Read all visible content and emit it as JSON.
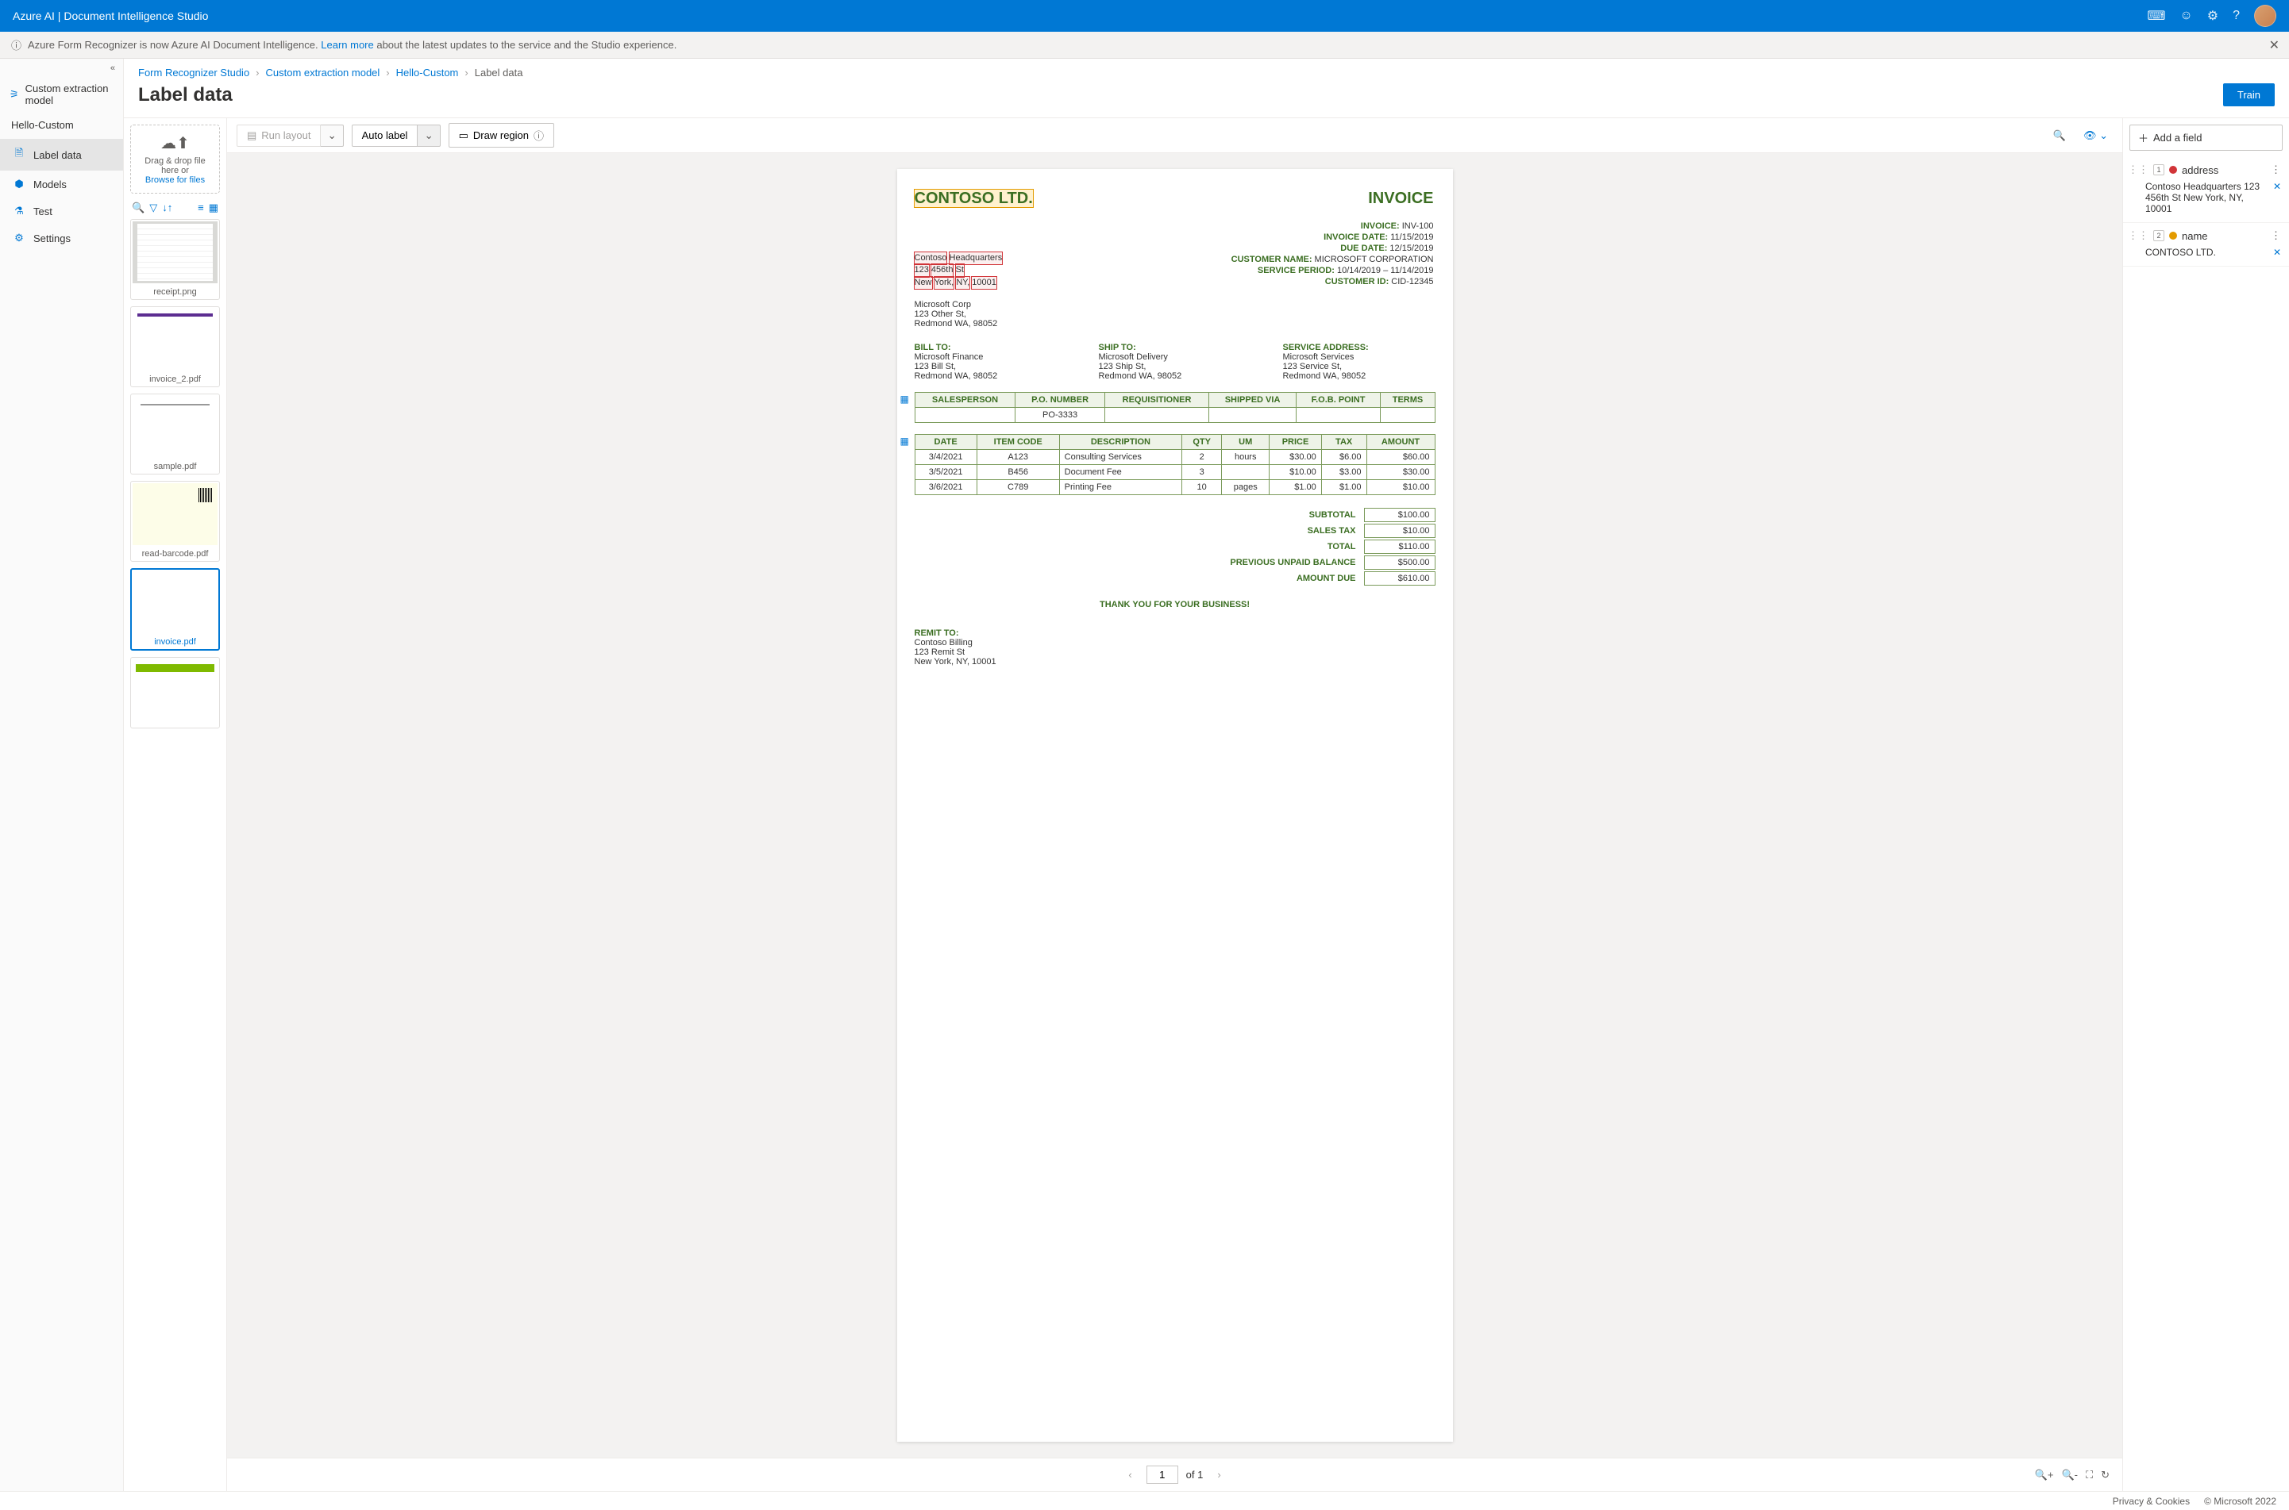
{
  "header": {
    "title": "Azure AI | Document Intelligence Studio"
  },
  "notif": {
    "prefix": "Azure Form Recognizer is now Azure AI Document Intelligence. ",
    "link": "Learn more",
    "suffix": " about the latest updates to the service and the Studio experience."
  },
  "nav": {
    "modelType": "Custom extraction model",
    "project": "Hello-Custom",
    "items": [
      {
        "label": "Label data",
        "icon": "🗎",
        "active": true
      },
      {
        "label": "Models",
        "icon": "⬢"
      },
      {
        "label": "Test",
        "icon": "⚗"
      },
      {
        "label": "Settings",
        "icon": "⚙"
      }
    ]
  },
  "breadcrumb": [
    {
      "label": "Form Recognizer Studio",
      "link": true
    },
    {
      "label": "Custom extraction model",
      "link": true
    },
    {
      "label": "Hello-Custom",
      "link": true
    },
    {
      "label": "Label data",
      "link": false
    }
  ],
  "pageTitle": "Label data",
  "trainLabel": "Train",
  "dropzone": {
    "line1": "Drag & drop file here or",
    "browse": "Browse for files"
  },
  "thumbnails": [
    {
      "name": "receipt.png",
      "cls": "receipt",
      "checked": true
    },
    {
      "name": "invoice_2.pdf",
      "cls": "inv",
      "checked": true
    },
    {
      "name": "sample.pdf",
      "cls": "sample",
      "checked": true
    },
    {
      "name": "read-barcode.pdf",
      "cls": "barcode",
      "checked": true
    },
    {
      "name": "invoice.pdf",
      "cls": "invoicepdf",
      "checked": true,
      "selected": true
    },
    {
      "name": "",
      "cls": "green",
      "checked": true
    }
  ],
  "toolbar": {
    "runLayout": "Run layout",
    "autoLabel": "Auto label",
    "drawRegion": "Draw region"
  },
  "doc": {
    "company": "CONTOSO LTD.",
    "invoiceWord": "INVOICE",
    "hq": {
      "line1a": "Contoso",
      "line1b": "Headquarters",
      "line2a": "123",
      "line2b": "456th",
      "line2c": "St",
      "line3a": "New",
      "line3b": "York,",
      "line3c": "NY,",
      "line3d": "10001"
    },
    "kv": [
      {
        "k": "INVOICE:",
        "v": "INV-100"
      },
      {
        "k": "INVOICE DATE:",
        "v": "11/15/2019"
      },
      {
        "k": "DUE DATE:",
        "v": "12/15/2019"
      },
      {
        "k": "CUSTOMER NAME:",
        "v": "MICROSOFT CORPORATION"
      },
      {
        "k": "SERVICE PERIOD:",
        "v": "10/14/2019 – 11/14/2019"
      },
      {
        "k": "CUSTOMER ID:",
        "v": "CID-12345"
      }
    ],
    "from": [
      "Microsoft Corp",
      "123 Other St,",
      "Redmond WA, 98052"
    ],
    "billTo": {
      "title": "BILL TO:",
      "lines": [
        "Microsoft Finance",
        "123 Bill St,",
        "Redmond WA, 98052"
      ]
    },
    "shipTo": {
      "title": "SHIP TO:",
      "lines": [
        "Microsoft Delivery",
        "123 Ship St,",
        "Redmond WA, 98052"
      ]
    },
    "svcAddr": {
      "title": "SERVICE ADDRESS:",
      "lines": [
        "Microsoft Services",
        "123 Service St,",
        "Redmond WA, 98052"
      ]
    },
    "t1head": [
      "SALESPERSON",
      "P.O. NUMBER",
      "REQUISITIONER",
      "SHIPPED VIA",
      "F.O.B. POINT",
      "TERMS"
    ],
    "t1row": [
      "",
      "PO-3333",
      "",
      "",
      "",
      ""
    ],
    "t2head": [
      "DATE",
      "ITEM CODE",
      "DESCRIPTION",
      "QTY",
      "UM",
      "PRICE",
      "TAX",
      "AMOUNT"
    ],
    "t2rows": [
      [
        "3/4/2021",
        "A123",
        "Consulting Services",
        "2",
        "hours",
        "$30.00",
        "$6.00",
        "$60.00"
      ],
      [
        "3/5/2021",
        "B456",
        "Document Fee",
        "3",
        "",
        "$10.00",
        "$3.00",
        "$30.00"
      ],
      [
        "3/6/2021",
        "C789",
        "Printing Fee",
        "10",
        "pages",
        "$1.00",
        "$1.00",
        "$10.00"
      ]
    ],
    "totals": [
      {
        "k": "SUBTOTAL",
        "v": "$100.00"
      },
      {
        "k": "SALES TAX",
        "v": "$10.00"
      },
      {
        "k": "TOTAL",
        "v": "$110.00"
      },
      {
        "k": "PREVIOUS UNPAID BALANCE",
        "v": "$500.00"
      },
      {
        "k": "AMOUNT DUE",
        "v": "$610.00"
      }
    ],
    "thank": "THANK YOU FOR YOUR BUSINESS!",
    "remit": {
      "title": "REMIT TO:",
      "lines": [
        "Contoso Billing",
        "123 Remit St",
        "New York, NY, 10001"
      ]
    }
  },
  "pager": {
    "current": "1",
    "of": "of 1"
  },
  "fieldsPanel": {
    "addField": "Add a field",
    "fields": [
      {
        "num": "1",
        "color": "#d13438",
        "name": "address",
        "value": "Contoso Headquarters 123 456th St New York, NY, 10001"
      },
      {
        "num": "2",
        "color": "#e39b00",
        "name": "name",
        "value": "CONTOSO LTD."
      }
    ]
  },
  "footer": {
    "privacy": "Privacy & Cookies",
    "copyright": "© Microsoft 2022"
  }
}
